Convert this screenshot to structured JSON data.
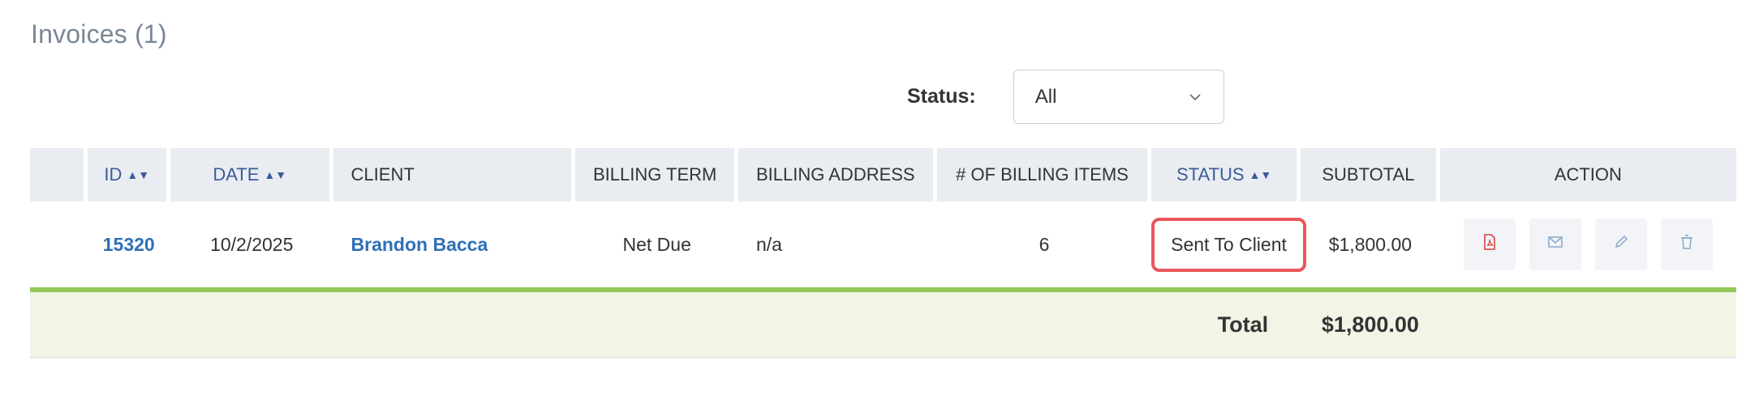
{
  "page": {
    "title": "Invoices (1)"
  },
  "filter": {
    "label": "Status:",
    "value": "All"
  },
  "table": {
    "columns": [
      {
        "label": "",
        "sortable": false
      },
      {
        "label": "ID",
        "sortable": true
      },
      {
        "label": "DATE",
        "sortable": true
      },
      {
        "label": "CLIENT",
        "sortable": false
      },
      {
        "label": "BILLING TERM",
        "sortable": false
      },
      {
        "label": "BILLING ADDRESS",
        "sortable": false
      },
      {
        "label": "# OF BILLING ITEMS",
        "sortable": false
      },
      {
        "label": "STATUS",
        "sortable": true
      },
      {
        "label": "SUBTOTAL",
        "sortable": false
      },
      {
        "label": "ACTION",
        "sortable": false
      }
    ],
    "rows": [
      {
        "id": "15320",
        "date": "10/2/2025",
        "client": "Brandon Bacca",
        "billing_term": "Net Due",
        "billing_address": "n/a",
        "billing_items": "6",
        "status": "Sent To Client",
        "subtotal": "$1,800.00",
        "actions": [
          "pdf-icon",
          "email-icon",
          "edit-icon",
          "delete-icon"
        ]
      }
    ],
    "total": {
      "label": "Total",
      "value": "$1,800.00"
    }
  },
  "colors": {
    "accent": "#2e6fb7",
    "highlight": "#e9565b",
    "divider": "#92c85a",
    "pdf": "#d84040"
  }
}
